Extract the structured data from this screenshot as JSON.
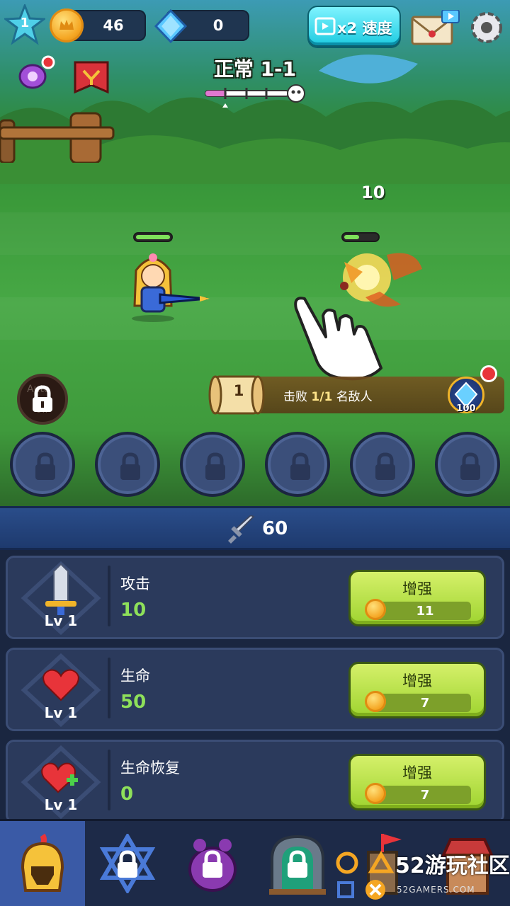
{
  "hud": {
    "player_level": "1",
    "coins": "46",
    "gems": "0",
    "speed_label": "x2 速度"
  },
  "stage": {
    "title": "正常 1-1"
  },
  "battle": {
    "damage_number": "10",
    "hero_hp_fraction": 1.0,
    "enemy_hp_fraction": 0.5
  },
  "quest": {
    "index": "1",
    "text_prefix": "击败",
    "progress": "1/1",
    "text_suffix": "名敌人",
    "reward": "100"
  },
  "auto_button": {
    "label": "Auto",
    "sub": "Off"
  },
  "power": {
    "value": "60"
  },
  "upgrades": [
    {
      "name": "攻击",
      "value": "10",
      "level": "Lv 1",
      "button": "增强",
      "cost": "11",
      "icon": "sword-icon"
    },
    {
      "name": "生命",
      "value": "50",
      "level": "Lv 1",
      "button": "增强",
      "cost": "7",
      "icon": "heart-icon"
    },
    {
      "name": "生命恢复",
      "value": "0",
      "level": "Lv 1",
      "button": "增强",
      "cost": "7",
      "icon": "heart-plus-icon"
    }
  ],
  "nav": {
    "tabs": [
      "helmet-icon",
      "star-lock-icon",
      "paw-lock-icon",
      "gate-lock-icon",
      "tower-lock-icon",
      "shop-lock-icon"
    ]
  },
  "watermark": {
    "text": "52游玩社区",
    "sub": "52GAMERS.COM"
  },
  "colors": {
    "accent_green": "#8ee05a",
    "button_lime": "#b5e04a",
    "speed_cyan": "#1ecbe0",
    "panel_navy": "#2b3a5c"
  }
}
